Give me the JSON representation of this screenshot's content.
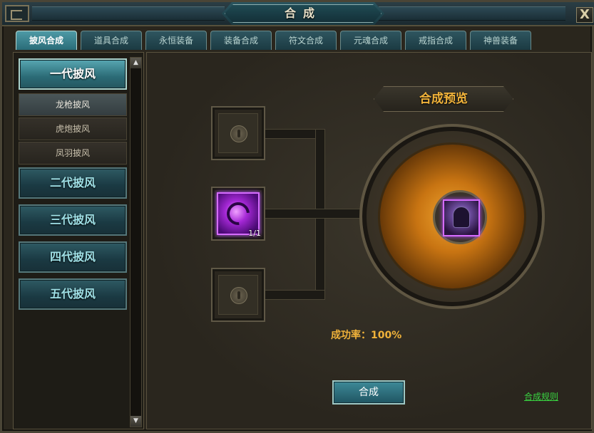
{
  "window": {
    "title": "合成",
    "close_label": "X"
  },
  "tabs": [
    {
      "label": "披风合成",
      "active": true
    },
    {
      "label": "道具合成",
      "active": false
    },
    {
      "label": "永恒装备",
      "active": false
    },
    {
      "label": "装备合成",
      "active": false
    },
    {
      "label": "符文合成",
      "active": false
    },
    {
      "label": "元魂合成",
      "active": false
    },
    {
      "label": "戒指合成",
      "active": false
    },
    {
      "label": "神兽装备",
      "active": false
    }
  ],
  "sidebar": {
    "categories": [
      {
        "label": "一代披风",
        "expanded": true
      },
      {
        "label": "二代披风",
        "expanded": false
      },
      {
        "label": "三代披风",
        "expanded": false
      },
      {
        "label": "四代披风",
        "expanded": false
      },
      {
        "label": "五代披风",
        "expanded": false
      }
    ],
    "sub_items": [
      {
        "label": "龙枪披风",
        "selected": true
      },
      {
        "label": "虎炮披风",
        "selected": false
      },
      {
        "label": "凤羽披风",
        "selected": false
      }
    ],
    "scroll_up": "▲",
    "scroll_down": "▼"
  },
  "main": {
    "preview_title": "合成预览",
    "material": {
      "count": "1/1",
      "icon": "purple-cloak-material-icon",
      "rarity_color": "#d66cff"
    },
    "locked_slots": [
      "lock-icon",
      "lock-icon"
    ],
    "result": {
      "icon": "hooded-cloak-icon",
      "rarity_color": "#d66cff"
    },
    "success_rate": "成功率：100%",
    "combine_button": "合成",
    "rules_link": "合成规则"
  }
}
